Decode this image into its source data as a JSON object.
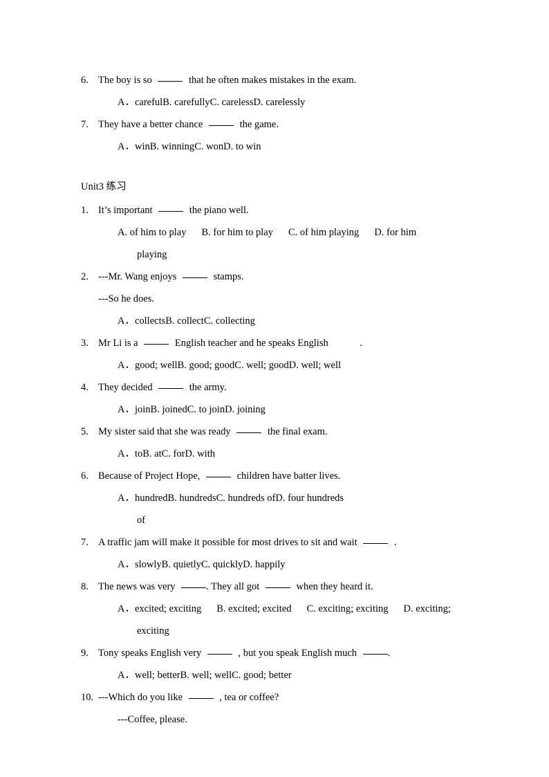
{
  "document": {
    "section_heading": "Unit3 练习",
    "blank_symbol": "_____"
  },
  "top_questions": [
    {
      "number": "6.",
      "stem_before": "The boy is so",
      "stem_after": "that he often makes mistakes in the exam.",
      "options": [
        "A．careful",
        "B. carefully",
        "C. careless",
        "D. carelessly"
      ]
    },
    {
      "number": "7.",
      "stem_before": "They have a better chance",
      "stem_after": "the game.",
      "options": [
        "A．win",
        "B. winning",
        "C. won",
        "D. to win"
      ]
    }
  ],
  "unit3_questions": [
    {
      "number": "1.",
      "stem_before": "It’s important",
      "stem_after": "the piano well.",
      "options": [
        "A. of him to play",
        "B. for him to play",
        "C. of him playing",
        "D. for him"
      ],
      "continuation": "playing"
    },
    {
      "number": "2.",
      "stem_before": "---Mr. Wang enjoys",
      "stem_after": "stamps.",
      "reply": "---So he does.",
      "options": [
        "A．collects",
        "B. collect",
        "C. collecting"
      ]
    },
    {
      "number": "3.",
      "stem_before": "Mr Li is a",
      "stem_after": "English teacher and he speaks English",
      "stem_tail": ".",
      "options": [
        "A．good; well",
        "B. good; good",
        "C. well; good",
        "D. well; well"
      ]
    },
    {
      "number": "4.",
      "stem_before": "They decided",
      "stem_after": "the army.",
      "options": [
        "A．join",
        "B. joined",
        "C. to join",
        "D. joining"
      ]
    },
    {
      "number": "5.",
      "stem_before": "My sister said that she was ready",
      "stem_after": "the final exam.",
      "options": [
        "A．to",
        "B. at",
        "C. for",
        "D. with"
      ]
    },
    {
      "number": "6.",
      "stem_before": "Because of Project Hope,",
      "stem_after": "children have batter lives.",
      "options": [
        "A．hundred",
        "B. hundreds",
        "C. hundreds of",
        "D. four hundreds"
      ],
      "continuation": "of"
    },
    {
      "number": "7.",
      "stem_before": "A traffic jam will make it possible for most drives to sit and wait",
      "stem_after": ".",
      "options": [
        "A．slowly",
        "B. quietly",
        "C. quickly",
        "D. happily"
      ]
    },
    {
      "number": "8.",
      "stem_before": "The news was very",
      "stem_mid": ". They all got",
      "stem_after": "when they heard it.",
      "options": [
        "A．excited; exciting",
        "B. excited; excited",
        "C. exciting; exciting",
        "D. exciting;"
      ],
      "continuation": "exciting"
    },
    {
      "number": "9.",
      "stem_before": "Tony speaks English very",
      "stem_mid": ", but you speak English much",
      "stem_after": ".",
      "options": [
        "A．well; better",
        "B. well; well",
        "C. good; better"
      ]
    },
    {
      "number": "10.",
      "stem_before": "---Which do you like",
      "stem_after": ", tea or coffee?",
      "reply": "---Coffee, please."
    }
  ]
}
